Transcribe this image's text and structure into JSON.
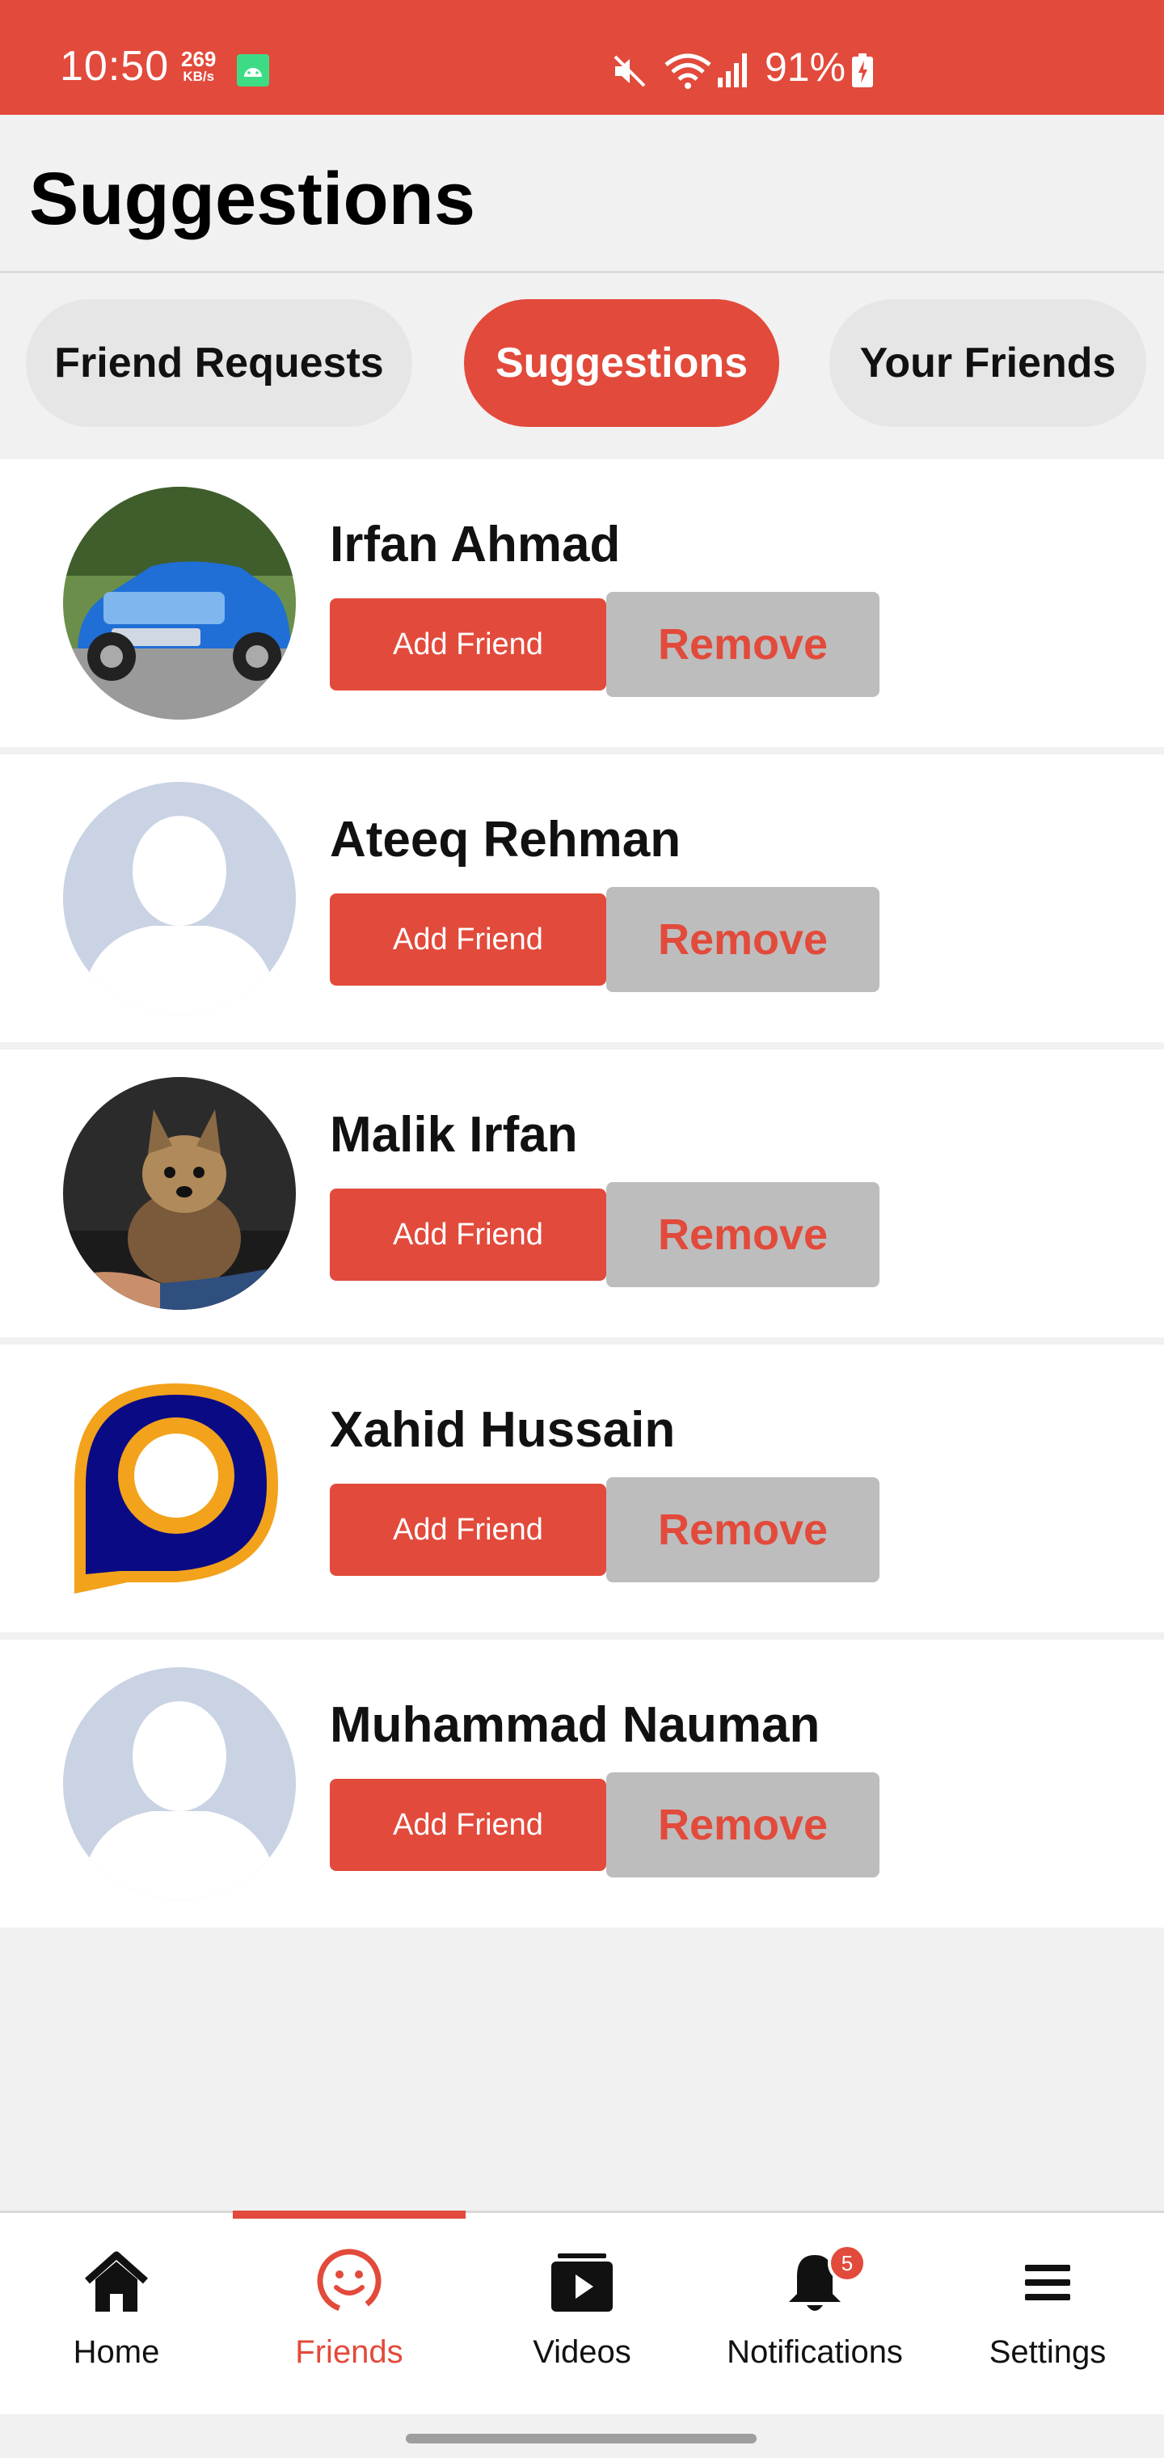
{
  "status_bar": {
    "time": "10:50",
    "net_speed": "269",
    "net_unit": "KB/s",
    "battery": "91%"
  },
  "header": {
    "title": "Suggestions"
  },
  "tabs": [
    {
      "label": "Friend Requests",
      "active": false
    },
    {
      "label": "Suggestions",
      "active": true
    },
    {
      "label": "Your Friends",
      "active": false
    }
  ],
  "suggestions": [
    {
      "name": "Irfan Ahmad",
      "avatar": "car-photo",
      "add_label": "Add Friend",
      "remove_label": "Remove"
    },
    {
      "name": "Ateeq Rehman",
      "avatar": "default-person",
      "add_label": "Add Friend",
      "remove_label": "Remove"
    },
    {
      "name": "Malik Irfan",
      "avatar": "dog-photo",
      "add_label": "Add Friend",
      "remove_label": "Remove"
    },
    {
      "name": "Xahid Hussain",
      "avatar": "logo-p",
      "add_label": "Add Friend",
      "remove_label": "Remove"
    },
    {
      "name": "Muhammad Nauman",
      "avatar": "default-person",
      "add_label": "Add Friend",
      "remove_label": "Remove"
    }
  ],
  "bottom_nav": [
    {
      "label": "Home",
      "icon": "home-icon",
      "active": false
    },
    {
      "label": "Friends",
      "icon": "friends-icon",
      "active": true
    },
    {
      "label": "Videos",
      "icon": "videos-icon",
      "active": false
    },
    {
      "label": "Notifications",
      "icon": "bell-icon",
      "active": false,
      "badge": "5"
    },
    {
      "label": "Settings",
      "icon": "menu-icon",
      "active": false
    }
  ],
  "colors": {
    "accent": "#e24a3b",
    "remove_bg": "#bdbdbd",
    "tab_bg": "#e6e6e6",
    "page_bg": "#f1f1f1"
  }
}
